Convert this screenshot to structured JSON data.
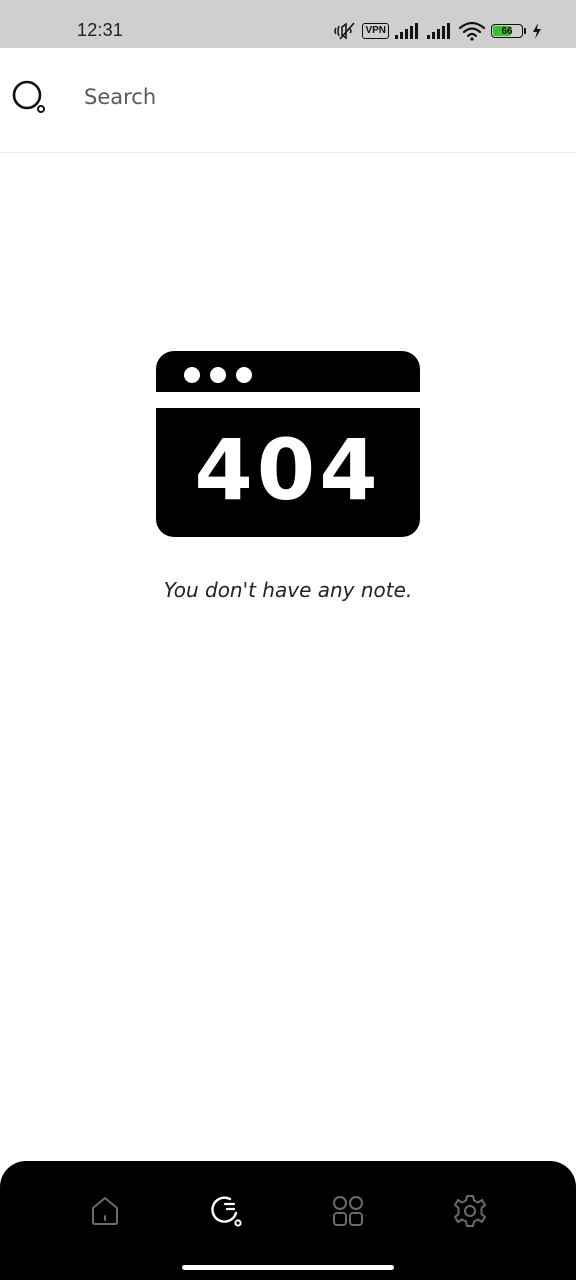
{
  "status_bar": {
    "time": "12:31",
    "vpn_label": "VPN",
    "battery_level": "66",
    "battery_fraction": 0.66,
    "icons": [
      "mute-icon",
      "vpn-badge",
      "signal-icon",
      "signal-icon",
      "wifi-icon",
      "battery-icon",
      "charging-icon"
    ]
  },
  "search": {
    "placeholder": "Search",
    "icon": "search-icon"
  },
  "empty_state": {
    "illustration_code": "404",
    "message": "You don't have any note."
  },
  "bottom_nav": {
    "items": [
      {
        "icon": "home-icon",
        "active": false
      },
      {
        "icon": "search-icon",
        "active": true
      },
      {
        "icon": "grid-icon",
        "active": false
      },
      {
        "icon": "gear-icon",
        "active": false
      }
    ]
  },
  "colors": {
    "status_bar_bg": "#cfcfcf",
    "battery_fill": "#35c22e",
    "nav_bg": "#000000",
    "nav_icon_inactive": "#6b6b6b",
    "nav_icon_active": "#ffffff"
  }
}
